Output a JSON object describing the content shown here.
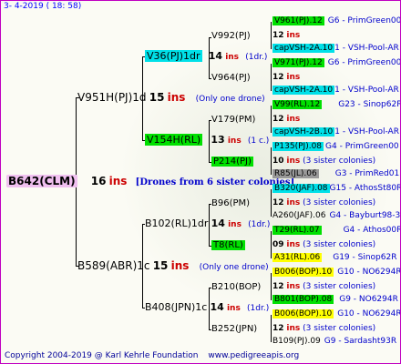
{
  "header": {
    "date": "3-  4-2019 ( 18: 58)"
  },
  "footer": {
    "copyright": "Copyright 2004-2019 @ Karl Kehrle Foundation",
    "site": "www.pedigreeapis.org"
  },
  "root": {
    "name": "B642(CLM)",
    "num": "16",
    "ins": "ins",
    "note": "[Drones from 6 sister colonies]"
  },
  "gen1": [
    {
      "name": "V951H(PJ)1d",
      "num": "15",
      "ins": "ins",
      "note": "(Only one drone)"
    },
    {
      "name": "B589(ABR)1c",
      "num": "15",
      "ins": "ins",
      "note": "(Only one drone)"
    }
  ],
  "gen2": [
    {
      "name": "V36(PJ)1dr",
      "num": "14",
      "ins": "ins",
      "note": "(1dr.)"
    },
    {
      "name": "V154H(RL)",
      "num": "13",
      "ins": "ins",
      "note": "(1 c.)"
    },
    {
      "name": "B102(RL)1dr",
      "num": "14",
      "ins": "ins",
      "note": "(1dr.)"
    },
    {
      "name": "B408(JPN)1c",
      "num": "14",
      "ins": "ins",
      "note": "(1dr.)"
    }
  ],
  "gen3": [
    {
      "name": "V992(PJ)"
    },
    {
      "name": "V964(PJ)"
    },
    {
      "name": "V179(PM)"
    },
    {
      "name": "P214(PJ)"
    },
    {
      "name": "B96(PM)"
    },
    {
      "name": "T8(RL)"
    },
    {
      "name": "B210(BOP)"
    },
    {
      "name": "B252(JPN)"
    }
  ],
  "gen4": [
    {
      "name": "V961(PJ).12",
      "code": "G6 - PrimGreen00"
    },
    {
      "count": "12",
      "ins": "ins"
    },
    {
      "name": "capVSH-2A.10",
      "code": "1 - VSH-Pool-AR"
    },
    {
      "name": "V971(PJ).12",
      "code": "G6 - PrimGreen00"
    },
    {
      "count": "12",
      "ins": "ins"
    },
    {
      "name": "capVSH-2A.10",
      "code": "1 - VSH-Pool-AR"
    },
    {
      "name": "V99(RL).12",
      "code": "G23 - Sinop62R"
    },
    {
      "count": "12",
      "ins": "ins"
    },
    {
      "name": "capVSH-2B.10",
      "code": "1 - VSH-Pool-AR"
    },
    {
      "name": "P135(PJ).08",
      "code": "G4 - PrimGreen00"
    },
    {
      "count": "10",
      "ins": "ins",
      "note": "(3 sister colonies)"
    },
    {
      "name": "R85(JL).06",
      "code": "G3 - PrimRed01"
    },
    {
      "name": "B320(JAF).08",
      "code": "G15 - AthosSt80R"
    },
    {
      "count": "12",
      "ins": "ins",
      "note": "(3 sister colonies)"
    },
    {
      "name": "A260(JAF).06",
      "code": "G4 - Bayburt98-3"
    },
    {
      "name": "T29(RL).07",
      "code": "G4 - Athos00R"
    },
    {
      "count": "09",
      "ins": "ins",
      "note": "(3 sister colonies)"
    },
    {
      "name": "A31(RL).06",
      "code": "G19 - Sinop62R"
    },
    {
      "name": "B006(BOP).10",
      "code": "G10 - NO6294R"
    },
    {
      "count": "12",
      "ins": "ins",
      "note": "(3 sister colonies)"
    },
    {
      "name": "B801(BOP).08",
      "code": "G9 - NO6294R"
    },
    {
      "name": "B006(BOP).10",
      "code": "G10 - NO6294R"
    },
    {
      "count": "12",
      "ins": "ins",
      "note": "(3 sister colonies)"
    },
    {
      "name": "B109(PJ).09",
      "code": "G9 - Sardasht93R"
    }
  ]
}
